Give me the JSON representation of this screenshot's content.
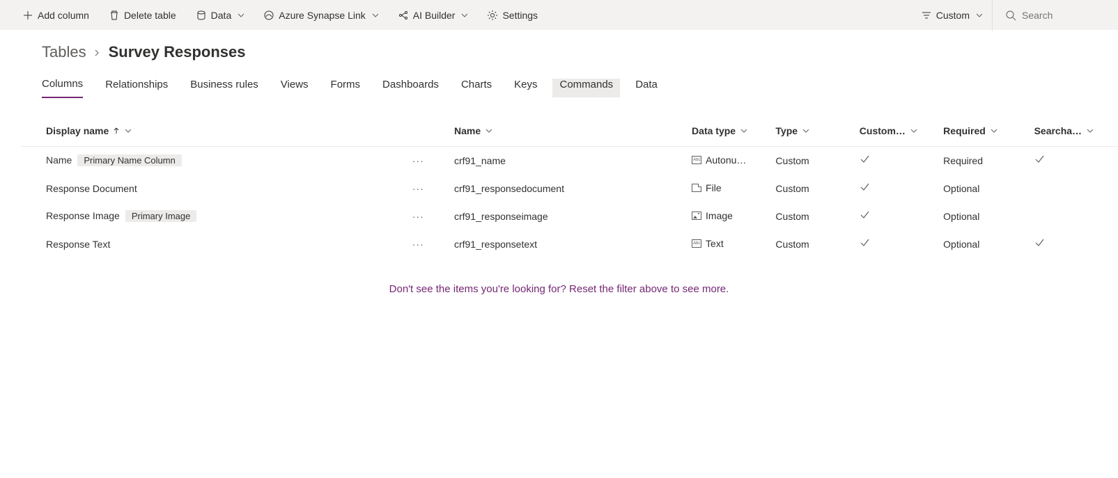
{
  "toolbar": {
    "add_column": "Add column",
    "delete_table": "Delete table",
    "data": "Data",
    "synapse": "Azure Synapse Link",
    "ai_builder": "AI Builder",
    "settings": "Settings",
    "custom": "Custom",
    "search_placeholder": "Search"
  },
  "breadcrumb": {
    "root": "Tables",
    "current": "Survey Responses"
  },
  "tabs": [
    "Columns",
    "Relationships",
    "Business rules",
    "Views",
    "Forms",
    "Dashboards",
    "Charts",
    "Keys",
    "Commands",
    "Data"
  ],
  "active_tab": "Columns",
  "hover_tab": "Commands",
  "columns": {
    "display": "Display name",
    "name": "Name",
    "datatype": "Data type",
    "type": "Type",
    "custom": "Custom…",
    "required": "Required",
    "searchable": "Searcha…"
  },
  "rows": [
    {
      "display": "Name",
      "badge": "Primary Name Column",
      "name": "crf91_name",
      "datatype_icon": "abc",
      "datatype": "Autonu…",
      "type": "Custom",
      "custom": true,
      "required": "Required",
      "searchable": true
    },
    {
      "display": "Response Document",
      "badge": "",
      "name": "crf91_responsedocument",
      "datatype_icon": "file",
      "datatype": "File",
      "type": "Custom",
      "custom": true,
      "required": "Optional",
      "searchable": false
    },
    {
      "display": "Response Image",
      "badge": "Primary Image",
      "name": "crf91_responseimage",
      "datatype_icon": "img",
      "datatype": "Image",
      "type": "Custom",
      "custom": true,
      "required": "Optional",
      "searchable": false
    },
    {
      "display": "Response Text",
      "badge": "",
      "name": "crf91_responsetext",
      "datatype_icon": "abc",
      "datatype": "Text",
      "type": "Custom",
      "custom": true,
      "required": "Optional",
      "searchable": true
    }
  ],
  "filter_msg": "Don't see the items you're looking for? Reset the filter above to see more."
}
